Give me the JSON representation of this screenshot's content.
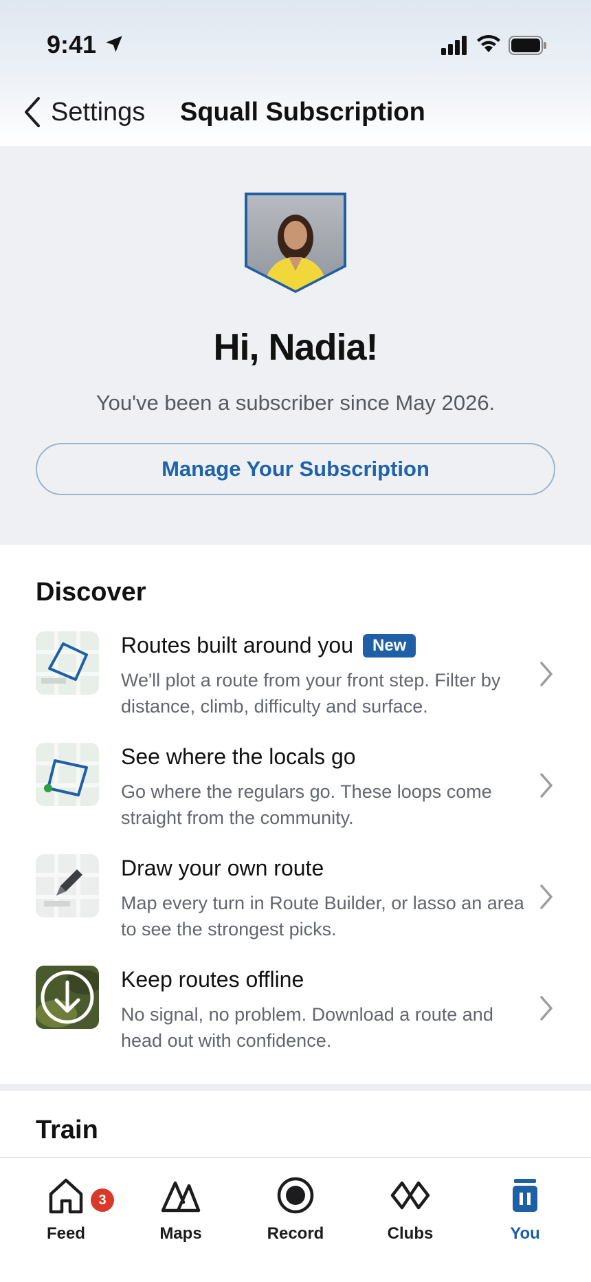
{
  "status": {
    "time": "9:41"
  },
  "nav": {
    "back_label": "Settings",
    "title": "Squall Subscription"
  },
  "hero": {
    "greeting": "Hi, Nadia!",
    "since": "You've been a subscriber since May 2026.",
    "manage_label": "Manage Your Subscription"
  },
  "discover": {
    "title": "Discover",
    "items": [
      {
        "title": "Routes built around you",
        "tag": "New",
        "desc": "We'll plot a route from your front step. Filter by distance, climb, difficulty and surface.",
        "icon": "route-map-icon"
      },
      {
        "title": "See where the locals go",
        "desc": "Go where the regulars go. These loops come straight from the community.",
        "icon": "community-route-icon"
      },
      {
        "title": "Draw your own route",
        "desc": "Map every turn in Route Builder, or lasso an area to see the strongest picks.",
        "icon": "pencil-route-icon"
      },
      {
        "title": "Keep routes offline",
        "desc": "No signal, no problem. Download a route and head out with confidence.",
        "icon": "download-icon"
      }
    ]
  },
  "train": {
    "title": "Train"
  },
  "tabs": [
    {
      "label": "Feed",
      "icon": "home-icon",
      "badge": "3"
    },
    {
      "label": "Maps",
      "icon": "maps-icon"
    },
    {
      "label": "Record",
      "icon": "record-icon"
    },
    {
      "label": "Clubs",
      "icon": "clubs-icon"
    },
    {
      "label": "You",
      "icon": "you-icon",
      "active": true
    }
  ],
  "colors": {
    "accent": "#1f5fa6",
    "badge_red": "#d8392b",
    "hero_bg": "#eef0f3"
  }
}
